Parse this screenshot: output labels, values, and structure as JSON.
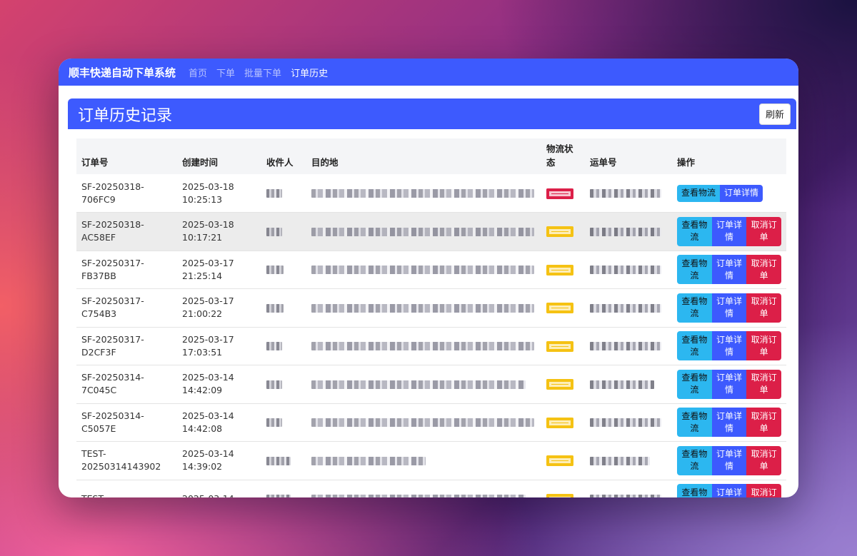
{
  "nav": {
    "brand": "顺丰快递自动下单系统",
    "links": [
      "首页",
      "下单",
      "批量下单",
      "订单历史"
    ],
    "active_index": 3
  },
  "card": {
    "title": "订单历史记录",
    "refresh_label": "刷新"
  },
  "table": {
    "columns": [
      "订单号",
      "创建时间",
      "收件人",
      "目的地",
      "物流状态",
      "运单号",
      "操作"
    ],
    "actions": {
      "track": "查看物流",
      "detail": "订单详情",
      "cancel": "取消订单"
    },
    "rows": [
      {
        "order_no": "SF-20250318-706FC9",
        "created": "2025-03-18 10:25:13",
        "status_color": "#dc1f48",
        "cancellable": false
      },
      {
        "order_no": "SF-20250318-AC58EF",
        "created": "2025-03-18 10:17:21",
        "status_color": "#f5c213",
        "cancellable": true
      },
      {
        "order_no": "SF-20250317-FB37BB",
        "created": "2025-03-17 21:25:14",
        "status_color": "#f5c213",
        "cancellable": true
      },
      {
        "order_no": "SF-20250317-C754B3",
        "created": "2025-03-17 21:00:22",
        "status_color": "#f5c213",
        "cancellable": true
      },
      {
        "order_no": "SF-20250317-D2CF3F",
        "created": "2025-03-17 17:03:51",
        "status_color": "#f5c213",
        "cancellable": true
      },
      {
        "order_no": "SF-20250314-7C045C",
        "created": "2025-03-14 14:42:09",
        "status_color": "#f5c213",
        "cancellable": true
      },
      {
        "order_no": "SF-20250314-C5057E",
        "created": "2025-03-14 14:42:08",
        "status_color": "#f5c213",
        "cancellable": true
      },
      {
        "order_no": "TEST-20250314143902",
        "created": "2025-03-14 14:39:02",
        "status_color": "#f5c213",
        "cancellable": true
      },
      {
        "order_no": "TEST-",
        "created": "2025-03-14",
        "status_color": "#f5c213",
        "cancellable": true
      }
    ]
  }
}
